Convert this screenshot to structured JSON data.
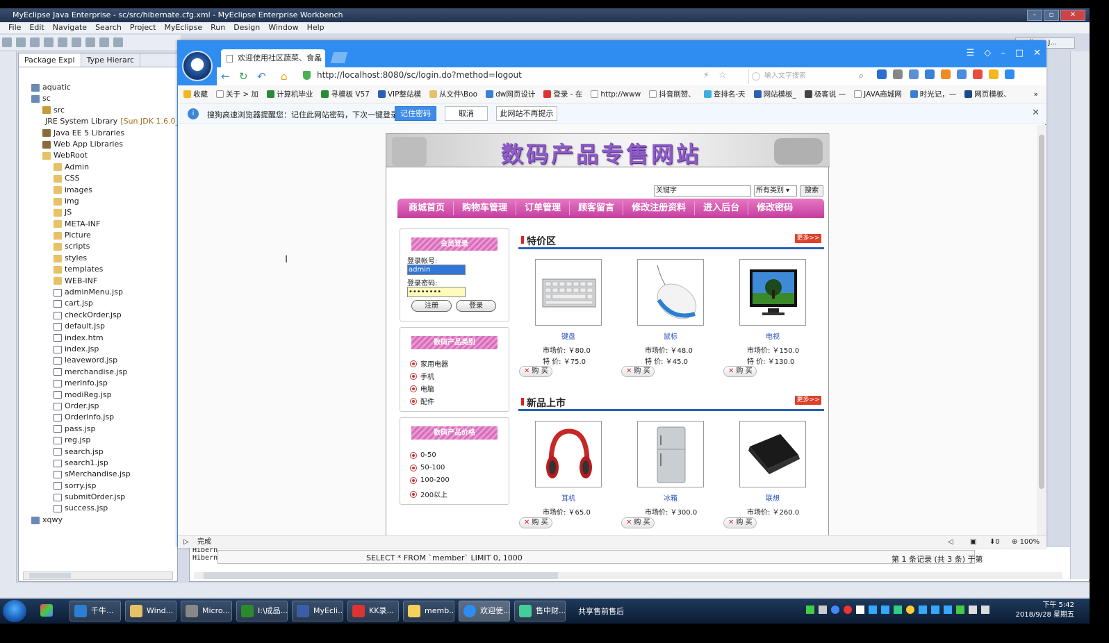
{
  "eclipse": {
    "title": "MyEclipse Java Enterprise - sc/src/hibernate.cfg.xml - MyEclipse Enterprise Workbench",
    "menu": [
      "File",
      "Edit",
      "Navigate",
      "Search",
      "Project",
      "MyEclipse",
      "Run",
      "Design",
      "Window",
      "Help"
    ],
    "tabs": [
      "Package Expl",
      "Type Hierarc"
    ],
    "tree": [
      {
        "label": "aquatic",
        "indent": 0,
        "icon": "prj"
      },
      {
        "label": "sc",
        "indent": 0,
        "icon": "prj"
      },
      {
        "label": "src",
        "indent": 1,
        "icon": "pkg"
      },
      {
        "label": "JRE System Library",
        "extra": "[Sun JDK 1.6.0_13]",
        "indent": 1,
        "icon": "lib"
      },
      {
        "label": "Java EE 5 Libraries",
        "indent": 1,
        "icon": "lib"
      },
      {
        "label": "Web App Libraries",
        "indent": 1,
        "icon": "lib"
      },
      {
        "label": "WebRoot",
        "indent": 1,
        "icon": "fold"
      },
      {
        "label": "Admin",
        "indent": 2,
        "icon": "fold"
      },
      {
        "label": "CSS",
        "indent": 2,
        "icon": "fold"
      },
      {
        "label": "images",
        "indent": 2,
        "icon": "fold"
      },
      {
        "label": "img",
        "indent": 2,
        "icon": "fold"
      },
      {
        "label": "JS",
        "indent": 2,
        "icon": "fold"
      },
      {
        "label": "META-INF",
        "indent": 2,
        "icon": "fold"
      },
      {
        "label": "Picture",
        "indent": 2,
        "icon": "fold"
      },
      {
        "label": "scripts",
        "indent": 2,
        "icon": "fold"
      },
      {
        "label": "styles",
        "indent": 2,
        "icon": "fold"
      },
      {
        "label": "templates",
        "indent": 2,
        "icon": "fold"
      },
      {
        "label": "WEB-INF",
        "indent": 2,
        "icon": "fold"
      },
      {
        "label": "adminMenu.jsp",
        "indent": 2,
        "icon": "file"
      },
      {
        "label": "cart.jsp",
        "indent": 2,
        "icon": "file"
      },
      {
        "label": "checkOrder.jsp",
        "indent": 2,
        "icon": "file"
      },
      {
        "label": "default.jsp",
        "indent": 2,
        "icon": "file"
      },
      {
        "label": "index.htm",
        "indent": 2,
        "icon": "file"
      },
      {
        "label": "index.jsp",
        "indent": 2,
        "icon": "file"
      },
      {
        "label": "leaveword.jsp",
        "indent": 2,
        "icon": "file"
      },
      {
        "label": "merchandise.jsp",
        "indent": 2,
        "icon": "file"
      },
      {
        "label": "merInfo.jsp",
        "indent": 2,
        "icon": "file"
      },
      {
        "label": "modiReg.jsp",
        "indent": 2,
        "icon": "file"
      },
      {
        "label": "Order.jsp",
        "indent": 2,
        "icon": "file"
      },
      {
        "label": "OrderInfo.jsp",
        "indent": 2,
        "icon": "file"
      },
      {
        "label": "pass.jsp",
        "indent": 2,
        "icon": "file"
      },
      {
        "label": "reg.jsp",
        "indent": 2,
        "icon": "file"
      },
      {
        "label": "search.jsp",
        "indent": 2,
        "icon": "file"
      },
      {
        "label": "search1.jsp",
        "indent": 2,
        "icon": "file"
      },
      {
        "label": "sMerchandise.jsp",
        "indent": 2,
        "icon": "file"
      },
      {
        "label": "sorry.jsp",
        "indent": 2,
        "icon": "file"
      },
      {
        "label": "submitOrder.jsp",
        "indent": 2,
        "icon": "file"
      },
      {
        "label": "success.jsp",
        "indent": 2,
        "icon": "file"
      },
      {
        "label": "xqwy",
        "indent": 0,
        "icon": "prj"
      }
    ],
    "console": {
      "lines": [
        "Hibern",
        "Hibern"
      ],
      "sql": "SELECT * FROM `member` LIMIT 0, 1000",
      "records": "第 1 条记录 (共 3 条) 于第"
    },
    "right_label": "lipse J..."
  },
  "browser": {
    "tab_title": "欢迎使用社区蔬菜、食品",
    "url": "http://localhost:8080/sc/login.do?method=logout",
    "search_placeholder": "输入文字搜索",
    "favorites": [
      "收藏",
      "关于 > 加",
      "计算机毕业",
      "寻模板 V57",
      "VIP整站模",
      "从文件\\Boo",
      "dw网页设计",
      "登录 - 在",
      "http://www",
      "抖音刷赞、",
      "查排名-天",
      "网站模板_",
      "极客说 —",
      "JAVA商城网",
      "时光记，—",
      "网页模板、"
    ],
    "infobar": {
      "message": "搜狗高速浏览器提醒您：记住此网站密码，下次一键登录！",
      "remember": "记住密码",
      "cancel": "取消",
      "never": "此网站不再提示"
    },
    "status": "完成",
    "zoom": "100%",
    "count": "0"
  },
  "site": {
    "banner_title": "数码产品专售网站",
    "search": {
      "keyword": "关键字",
      "category": "所有类别",
      "button": "搜索"
    },
    "nav": [
      "商城首页",
      "购物车管理",
      "订单管理",
      "顾客留言",
      "修改注册资料",
      "进入后台",
      "修改密码"
    ],
    "login": {
      "header": "会员登录",
      "account_label": "登录帐号:",
      "account_value": "admin",
      "password_label": "登录密码:",
      "password_value": "••••••••",
      "register": "注册",
      "login": "登录"
    },
    "categories": {
      "header": "数码产品类别",
      "items": [
        "家用电器",
        "手机",
        "电脑",
        "配件"
      ]
    },
    "prices": {
      "header": "数码产品价格",
      "items": [
        "0-50",
        "50-100",
        "100-200",
        "200以上"
      ]
    },
    "special": {
      "title": "特价区",
      "more": "更多>>",
      "products": [
        {
          "name": "键盘",
          "market": "市场价: ￥80.0",
          "special": "特 价: ￥75.0"
        },
        {
          "name": "鼠标",
          "market": "市场价: ￥48.0",
          "special": "特 价: ￥45.0"
        },
        {
          "name": "电视",
          "market": "市场价: ￥150.0",
          "special": "特 价: ￥130.0"
        }
      ]
    },
    "newproducts": {
      "title": "新品上市",
      "more": "更多>>",
      "products": [
        {
          "name": "耳机",
          "market": "市场价: ￥65.0"
        },
        {
          "name": "冰箱",
          "market": "市场价: ￥300.0"
        },
        {
          "name": "联想",
          "market": "市场价: ￥260.0"
        }
      ]
    },
    "buy_label": "购 买"
  },
  "taskbar": {
    "items": [
      "千牛...",
      "Wind...",
      "Micro...",
      "I:\\成品...",
      "MyEcli...",
      "KK录...",
      "memb...",
      "欢迎使...",
      "售中财..."
    ],
    "extra": "共享售前售后",
    "time": "下午 5:42",
    "date": "2018/9/28 星期五"
  }
}
